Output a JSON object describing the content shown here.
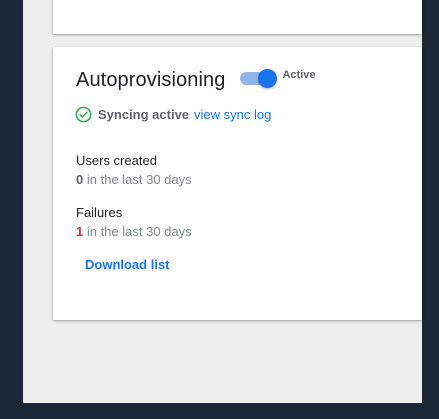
{
  "card": {
    "title": "Autoprovisioning",
    "toggle": {
      "state": "on",
      "label": "Active"
    },
    "sync": {
      "status": "Syncing active",
      "link": "view sync log",
      "icon": "check-circle-icon"
    },
    "stats": {
      "users_created": {
        "label": "Users created",
        "count": "0",
        "period": " in the last 30 days"
      },
      "failures": {
        "label": "Failures",
        "count": "1",
        "period": " in the last 30 days"
      }
    },
    "download_label": "Download list"
  },
  "colors": {
    "accent": "#1a73e8",
    "success": "#34a853",
    "error": "#d93025",
    "page_background": "#1c2738",
    "panel_background": "#eeeeee"
  }
}
